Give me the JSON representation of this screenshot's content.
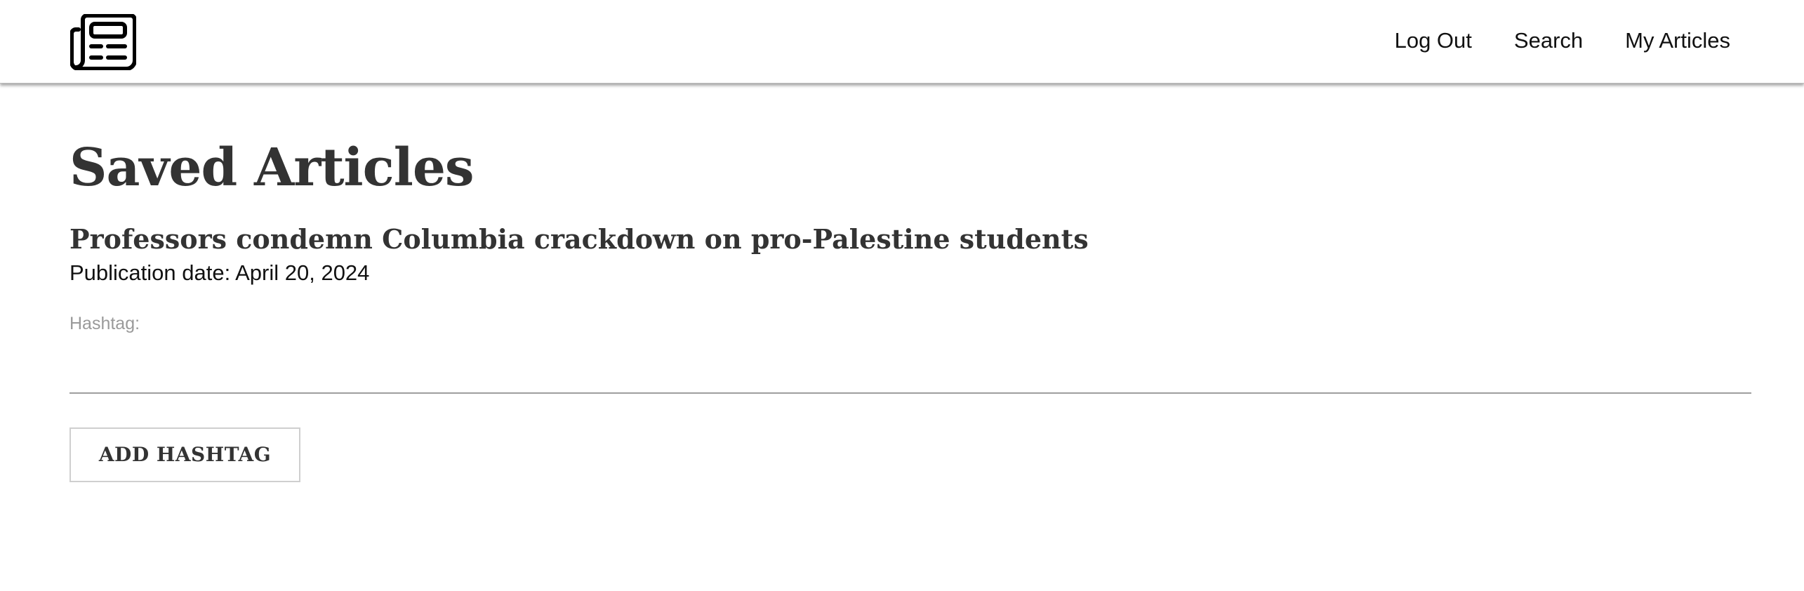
{
  "header": {
    "logo_icon": "newspaper-icon",
    "nav": {
      "logout": "Log Out",
      "search": "Search",
      "my_articles": "My Articles"
    }
  },
  "main": {
    "title": "Saved Articles",
    "article": {
      "title": "Professors condemn Columbia crackdown on pro-Palestine students",
      "publication_date": "Publication date: April 20, 2024",
      "hashtag_label": "Hashtag:",
      "hashtag_value": ""
    },
    "add_hashtag_label": "ADD HASHTAG"
  }
}
